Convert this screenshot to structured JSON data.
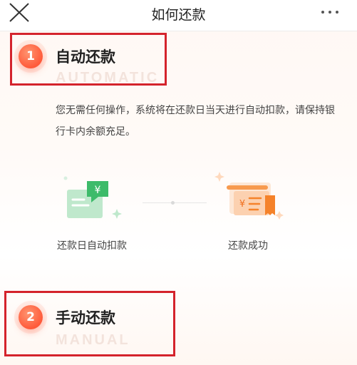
{
  "header": {
    "title": "如何还款",
    "close_icon": "close-icon",
    "more_icon": "more-icon"
  },
  "sections": [
    {
      "number": "1",
      "title": "自动还款",
      "subtitle": "AUTOMATIC"
    },
    {
      "number": "2",
      "title": "手动还款",
      "subtitle": "MANUAL"
    }
  ],
  "auto": {
    "description": "您无需任何操作，系统将在还款日当天进行自动扣款，请保持银行卡内余额充足。",
    "steps": [
      {
        "icon": "auto-deduct-icon",
        "label": "还款日自动扣款",
        "currency": "¥"
      },
      {
        "icon": "repay-success-icon",
        "label": "还款成功",
        "currency": "¥"
      }
    ]
  },
  "colors": {
    "accent": "#ff5a3a",
    "highlight_box": "#d4232c",
    "green_icon": "#5cc97a",
    "orange_icon": "#f5822a"
  }
}
